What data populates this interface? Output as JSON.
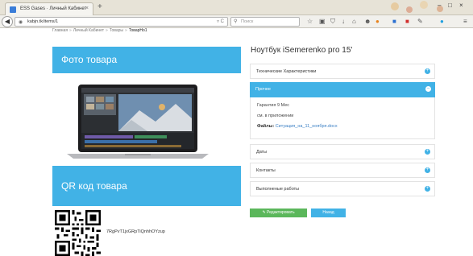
{
  "browser": {
    "tab_title": "ESS Gases · Личный Кабинет",
    "tab_close": "×",
    "new_tab": "+",
    "url": "kabjn.tk/items/1",
    "url_icons": "▿ C",
    "search_placeholder": "Поиск",
    "window_controls": [
      "–",
      "□",
      "×"
    ]
  },
  "breadcrumb": {
    "items": [
      "Главная",
      "Личный Кабинет",
      "Товары"
    ],
    "separator": "»",
    "current": "ТоварНо1"
  },
  "left": {
    "photo_header": "Фото товара",
    "qr_header": "QR код товара",
    "qr_code_text": "7RgPvT1jxGRpTiQnhhOYzup"
  },
  "product": {
    "title": "Ноутбук iSemerenko pro 15'"
  },
  "accordion": {
    "specs_label": "Технические Характеристики",
    "other_label": "Прочее",
    "other_body": {
      "warranty": "Гарантия 9 Мес",
      "attachment": "см. в приложении",
      "files_label": "Файлы:",
      "file_link": "Ситуация_на_11_ноября.docx"
    },
    "dates_label": "Даты",
    "contacts_label": "Контакты",
    "works_label": "Выполненые работы",
    "expand_symbol": "+",
    "collapse_symbol": "–"
  },
  "buttons": {
    "edit": "✎ Редактировать",
    "back": "Назад"
  },
  "colors": {
    "accent": "#41b2e6",
    "edit_button": "#5bb75b",
    "link": "#3a7fc4"
  },
  "icons": {
    "back": "back-arrow-icon",
    "globe": "globe-icon",
    "search": "search-icon",
    "toolbar": [
      "star-icon",
      "clipboard-icon",
      "shield-icon",
      "download-icon",
      "home-icon",
      "smiley-icon",
      "extension-icon",
      "extension-icon",
      "extension-icon",
      "extension-icon",
      "menu-icon"
    ]
  }
}
